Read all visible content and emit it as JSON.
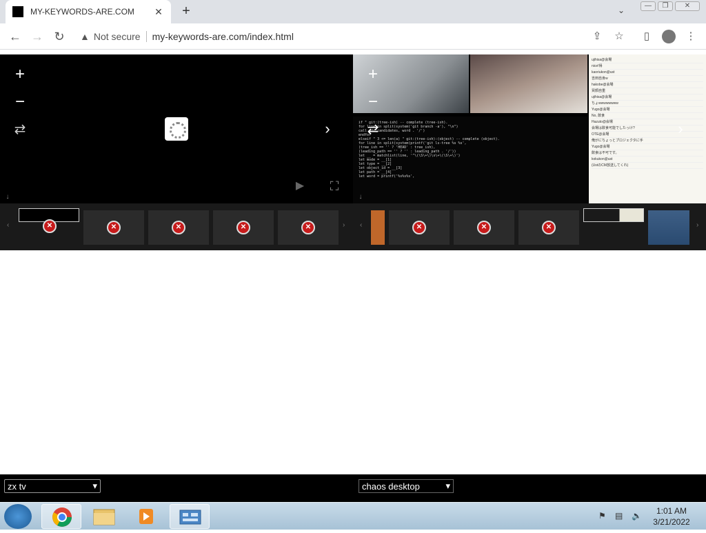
{
  "browser": {
    "tab_title": "MY-KEYWORDS-ARE.COM",
    "tab_close": "✕",
    "new_tab": "+",
    "tab_dropdown": "⌄",
    "window_controls": [
      "—",
      "❐",
      "✕"
    ],
    "nav": {
      "back": "←",
      "forward": "→",
      "reload": "↻"
    },
    "address": {
      "security_label": "Not secure",
      "url": "my-keywords-are.com/index.html"
    },
    "toolbar_icons": [
      "share-icon",
      "star-icon",
      "sidepanel-icon",
      "profile-icon",
      "menu-icon"
    ]
  },
  "players": {
    "left": {
      "controls": {
        "zoom_in": "+",
        "zoom_out": "−",
        "swap": "⇄",
        "next": "›",
        "play": "▶",
        "fullscreen": "⛶",
        "down": "↓"
      },
      "thumbnails": 5,
      "thumb_error": "✕",
      "prev_arrow": "‹",
      "next_arrow": "›"
    },
    "right": {
      "controls": {
        "zoom_in": "+",
        "zoom_out": "−",
        "swap": "⇄",
        "next": "›",
        "down": "↓"
      },
      "terminal_lines": [
        "if  \" git:(tree-ish) -- complete (tree-ish).",
        "  for line in split(system('git branch -a'), \"\\n\")",
        "     call add(candidates, word . '/')",
        "  endfor",
        "elseif \" 3 <= len(a) \" git:(tree-ish):(object) -- complete (object).",
        "  for line in split(system(printf('git ls-tree %s %s',",
        "        (tree_ish == '' ? 'HEAD' : tree_ish),",
        "        (leading_path == '' ? '' : leading_path . '/'))",
        "    let __ = matchlist(line, '^\\(\\S\\+\\)\\s\\+\\(\\S\\+\\)')",
        "    let mode = __[1]",
        "    let type = __[2]",
        "    let object_id = __[3]",
        "    let path = __[4]",
        "",
        "    let word = printf('%s%s%s',"
      ],
      "chat_lines": [
        "ujihisa@会場",
        "nice!得",
        "kaoriukon@ust",
        "吉田自身w",
        "hakobe@会場",
        "買顔自重",
        "ujihisa@会場",
        "ちょwwwwwwww",
        "Yugo@会場",
        "No, 飲食",
        "Hazuto@会場",
        "会場は飲食可能でしたっけ?",
        "OTE@会場",
        "俺がにちょっとプロジェクタに手",
        "Yugo@会場",
        "飲食は不可です。",
        "kokukon@ust",
        "(UstのCM放送してくれ)"
      ],
      "thumbnails": 3,
      "thumb_error": "✕",
      "prev_arrow": "‹",
      "next_arrow": "›"
    }
  },
  "selects": {
    "left": {
      "value": "zx tv",
      "arrow": "▾"
    },
    "right": {
      "value": "chaos desktop",
      "arrow": "▾"
    }
  },
  "taskbar": {
    "items": [
      "chrome-icon",
      "explorer-icon",
      "media-player-icon",
      "control-panel-icon"
    ],
    "tray_icons": [
      "flag-icon",
      "network-icon",
      "volume-icon"
    ],
    "time": "1:01 AM",
    "date": "3/21/2022"
  },
  "colors": {
    "tab_bar": "#dee1e6",
    "player_bg": "#000000",
    "error_red": "#c71b1b",
    "taskbar": "#b6cee0"
  }
}
